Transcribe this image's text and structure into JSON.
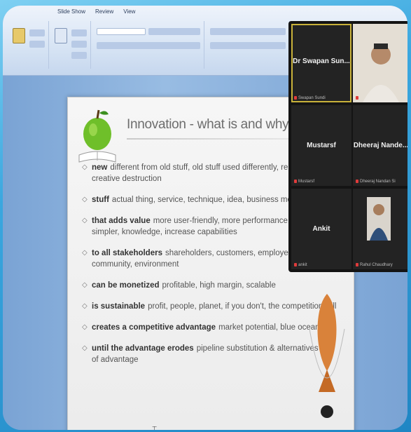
{
  "menu": [
    "Slide Show",
    "Review",
    "View"
  ],
  "slide": {
    "title": "Innovation - what is and why does",
    "bullets": [
      {
        "bold": "new",
        "text": "different from old stuff, old stuff used differently, rep",
        "text2": "creative destruction"
      },
      {
        "bold": "stuff",
        "text": "actual thing, service, technique, idea, business mo",
        "text2": ""
      },
      {
        "bold": "that adds value",
        "text": "more user-friendly, more performance,",
        "text2": "simpler, knowledge, increase capabilities"
      },
      {
        "bold": "to all stakeholders",
        "text": "shareholders, customers, employees, partners,",
        "text2": "community, environment"
      },
      {
        "bold": "can be monetized",
        "text": "profitable, high margin, scalable",
        "text2": ""
      },
      {
        "bold": "is sustainable",
        "text": "profit, people, planet, if you don't, the competition will",
        "text2": ""
      },
      {
        "bold": "creates a competitive advantage",
        "text": "market potential, blue ocean",
        "text2": ""
      },
      {
        "bold": "until the advantage erodes",
        "text": "pipeline substitution & alternatives en",
        "text2": "of advantage"
      }
    ]
  },
  "participants": [
    {
      "name": "Dr Swapan Sun...",
      "label": "Swapan Sundi",
      "video": false
    },
    {
      "name": "",
      "label": "",
      "video": true
    },
    {
      "name": "Mustarsf",
      "label": "Mustarsf",
      "video": false
    },
    {
      "name": "Dheeraj Nande...",
      "label": "Dheeraj Nandan Si",
      "video": false
    },
    {
      "name": "Ankit",
      "label": "ankit",
      "video": false
    },
    {
      "name": "",
      "label": "Rahul Chaudhary",
      "video": true
    }
  ],
  "colors": {
    "accent_border": "#c9b23a",
    "meeting_bg": "#141414",
    "mute": "#e03b3b"
  }
}
